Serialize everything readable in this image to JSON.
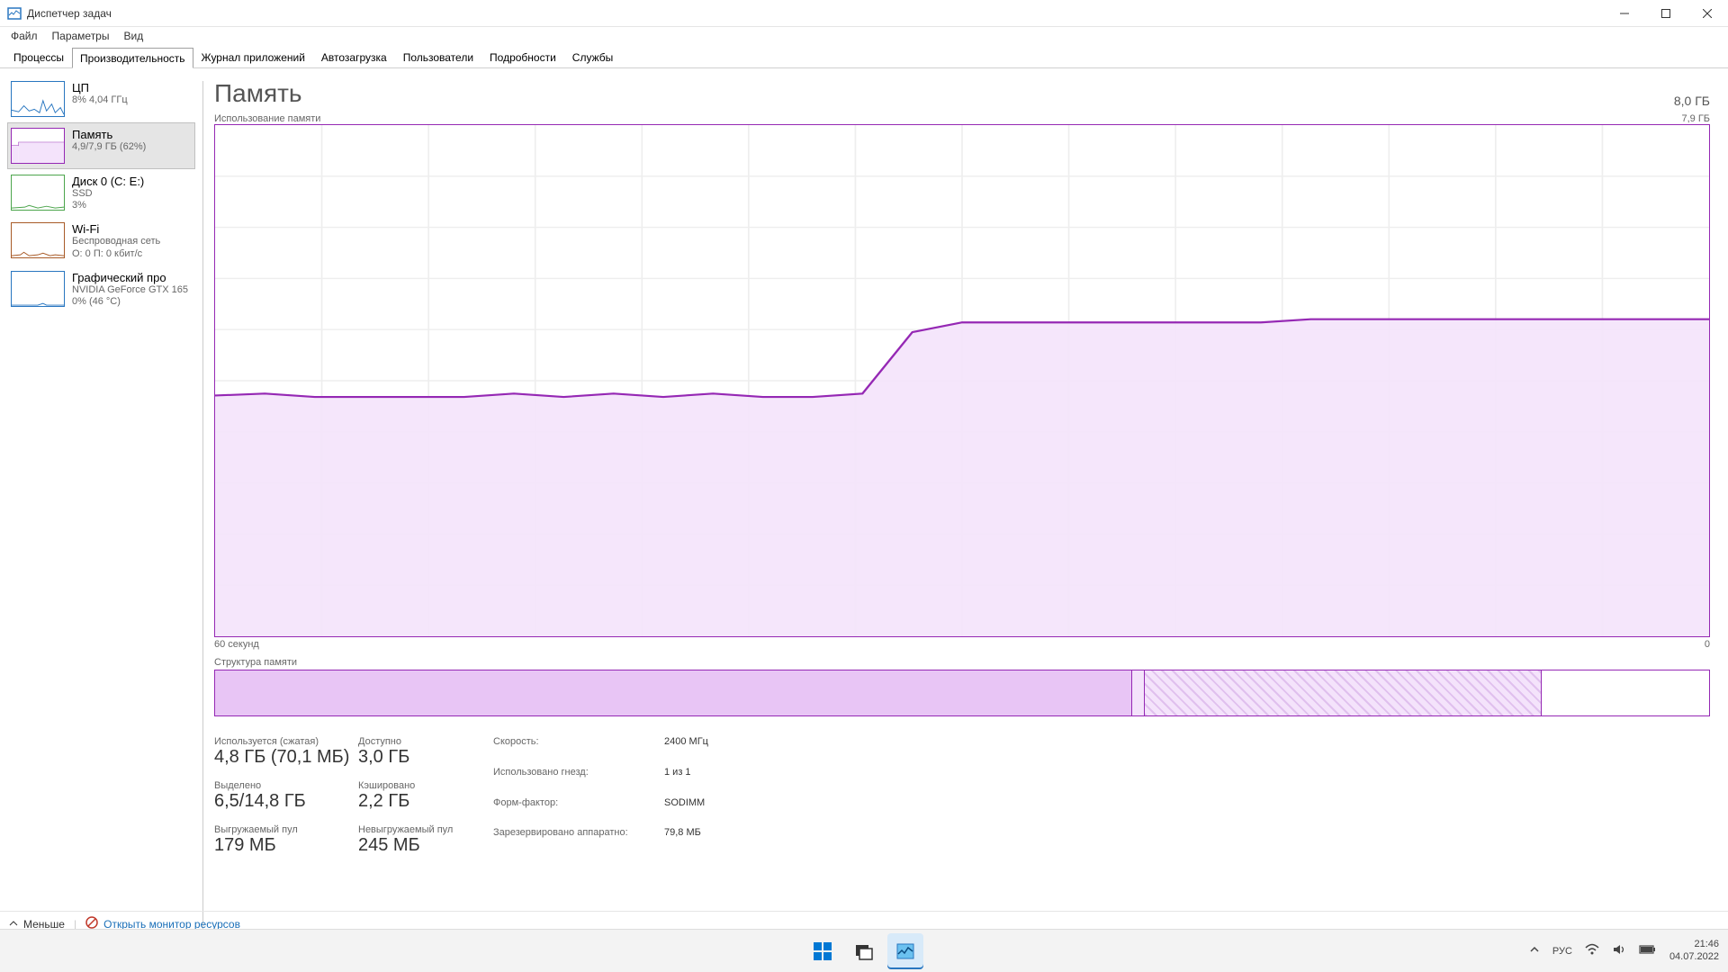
{
  "window": {
    "title": "Диспетчер задач"
  },
  "menu": {
    "file": "Файл",
    "options": "Параметры",
    "view": "Вид"
  },
  "tabs": {
    "processes": "Процессы",
    "performance": "Производительность",
    "app_history": "Журнал приложений",
    "startup": "Автозагрузка",
    "users": "Пользователи",
    "details": "Подробности",
    "services": "Службы"
  },
  "sidebar": {
    "cpu": {
      "title": "ЦП",
      "sub": "8%  4,04 ГГц"
    },
    "memory": {
      "title": "Память",
      "sub": "4,9/7,9 ГБ (62%)"
    },
    "disk": {
      "title": "Диск 0 (C: E:)",
      "sub1": "SSD",
      "sub2": "3%"
    },
    "wifi": {
      "title": "Wi-Fi",
      "sub1": "Беспроводная сеть",
      "sub2": "О: 0 П: 0 кбит/с"
    },
    "gpu": {
      "title": "Графический про",
      "sub1": "NVIDIA GeForce GTX 165",
      "sub2": "0%  (46 °C)"
    }
  },
  "header": {
    "title": "Память",
    "capacity": "8,0 ГБ"
  },
  "chart": {
    "top_left": "Использование памяти",
    "top_right": "7,9 ГБ",
    "bottom_left": "60 секунд",
    "bottom_right": "0"
  },
  "composition": {
    "label": "Структура памяти"
  },
  "stats": {
    "in_use_label": "Используется (сжатая)",
    "in_use": "4,8 ГБ (70,1 МБ)",
    "available_label": "Доступно",
    "available": "3,0 ГБ",
    "committed_label": "Выделено",
    "committed": "6,5/14,8 ГБ",
    "cached_label": "Кэшировано",
    "cached": "2,2 ГБ",
    "paged_label": "Выгружаемый пул",
    "paged": "179 МБ",
    "nonpaged_label": "Невыгружаемый пул",
    "nonpaged": "245 МБ",
    "speed_label": "Скорость:",
    "speed": "2400 МГц",
    "slots_label": "Использовано гнезд:",
    "slots": "1 из 1",
    "form_label": "Форм-фактор:",
    "form": "SODIMM",
    "reserved_label": "Зарезервировано аппаратно:",
    "reserved": "79,8 МБ"
  },
  "bottom": {
    "less": "Меньше",
    "resmon": "Открыть монитор ресурсов"
  },
  "systray": {
    "lang": "РУС",
    "time": "21:46",
    "date": "04.07.2022"
  },
  "chart_data": {
    "type": "area",
    "title": "Использование памяти",
    "xlabel": "60 секунд",
    "ylabel": "ГБ",
    "ylim": [
      0,
      7.9
    ],
    "x": [
      0,
      2,
      4,
      6,
      8,
      10,
      12,
      14,
      16,
      18,
      20,
      22,
      24,
      26,
      28,
      30,
      32,
      34,
      36,
      38,
      40,
      42,
      44,
      46,
      48,
      50,
      52,
      54,
      56,
      58,
      60
    ],
    "values": [
      4.9,
      4.9,
      4.9,
      4.9,
      4.9,
      4.9,
      4.9,
      4.9,
      4.9,
      4.85,
      4.85,
      4.85,
      4.85,
      4.85,
      4.85,
      4.85,
      4.7,
      3.75,
      3.7,
      3.7,
      3.75,
      3.7,
      3.75,
      3.7,
      3.75,
      3.7,
      3.7,
      3.7,
      3.7,
      3.75,
      3.72
    ]
  },
  "composition_data": {
    "segments_pct": [
      61.4,
      0.8,
      26.6,
      11.2
    ]
  }
}
